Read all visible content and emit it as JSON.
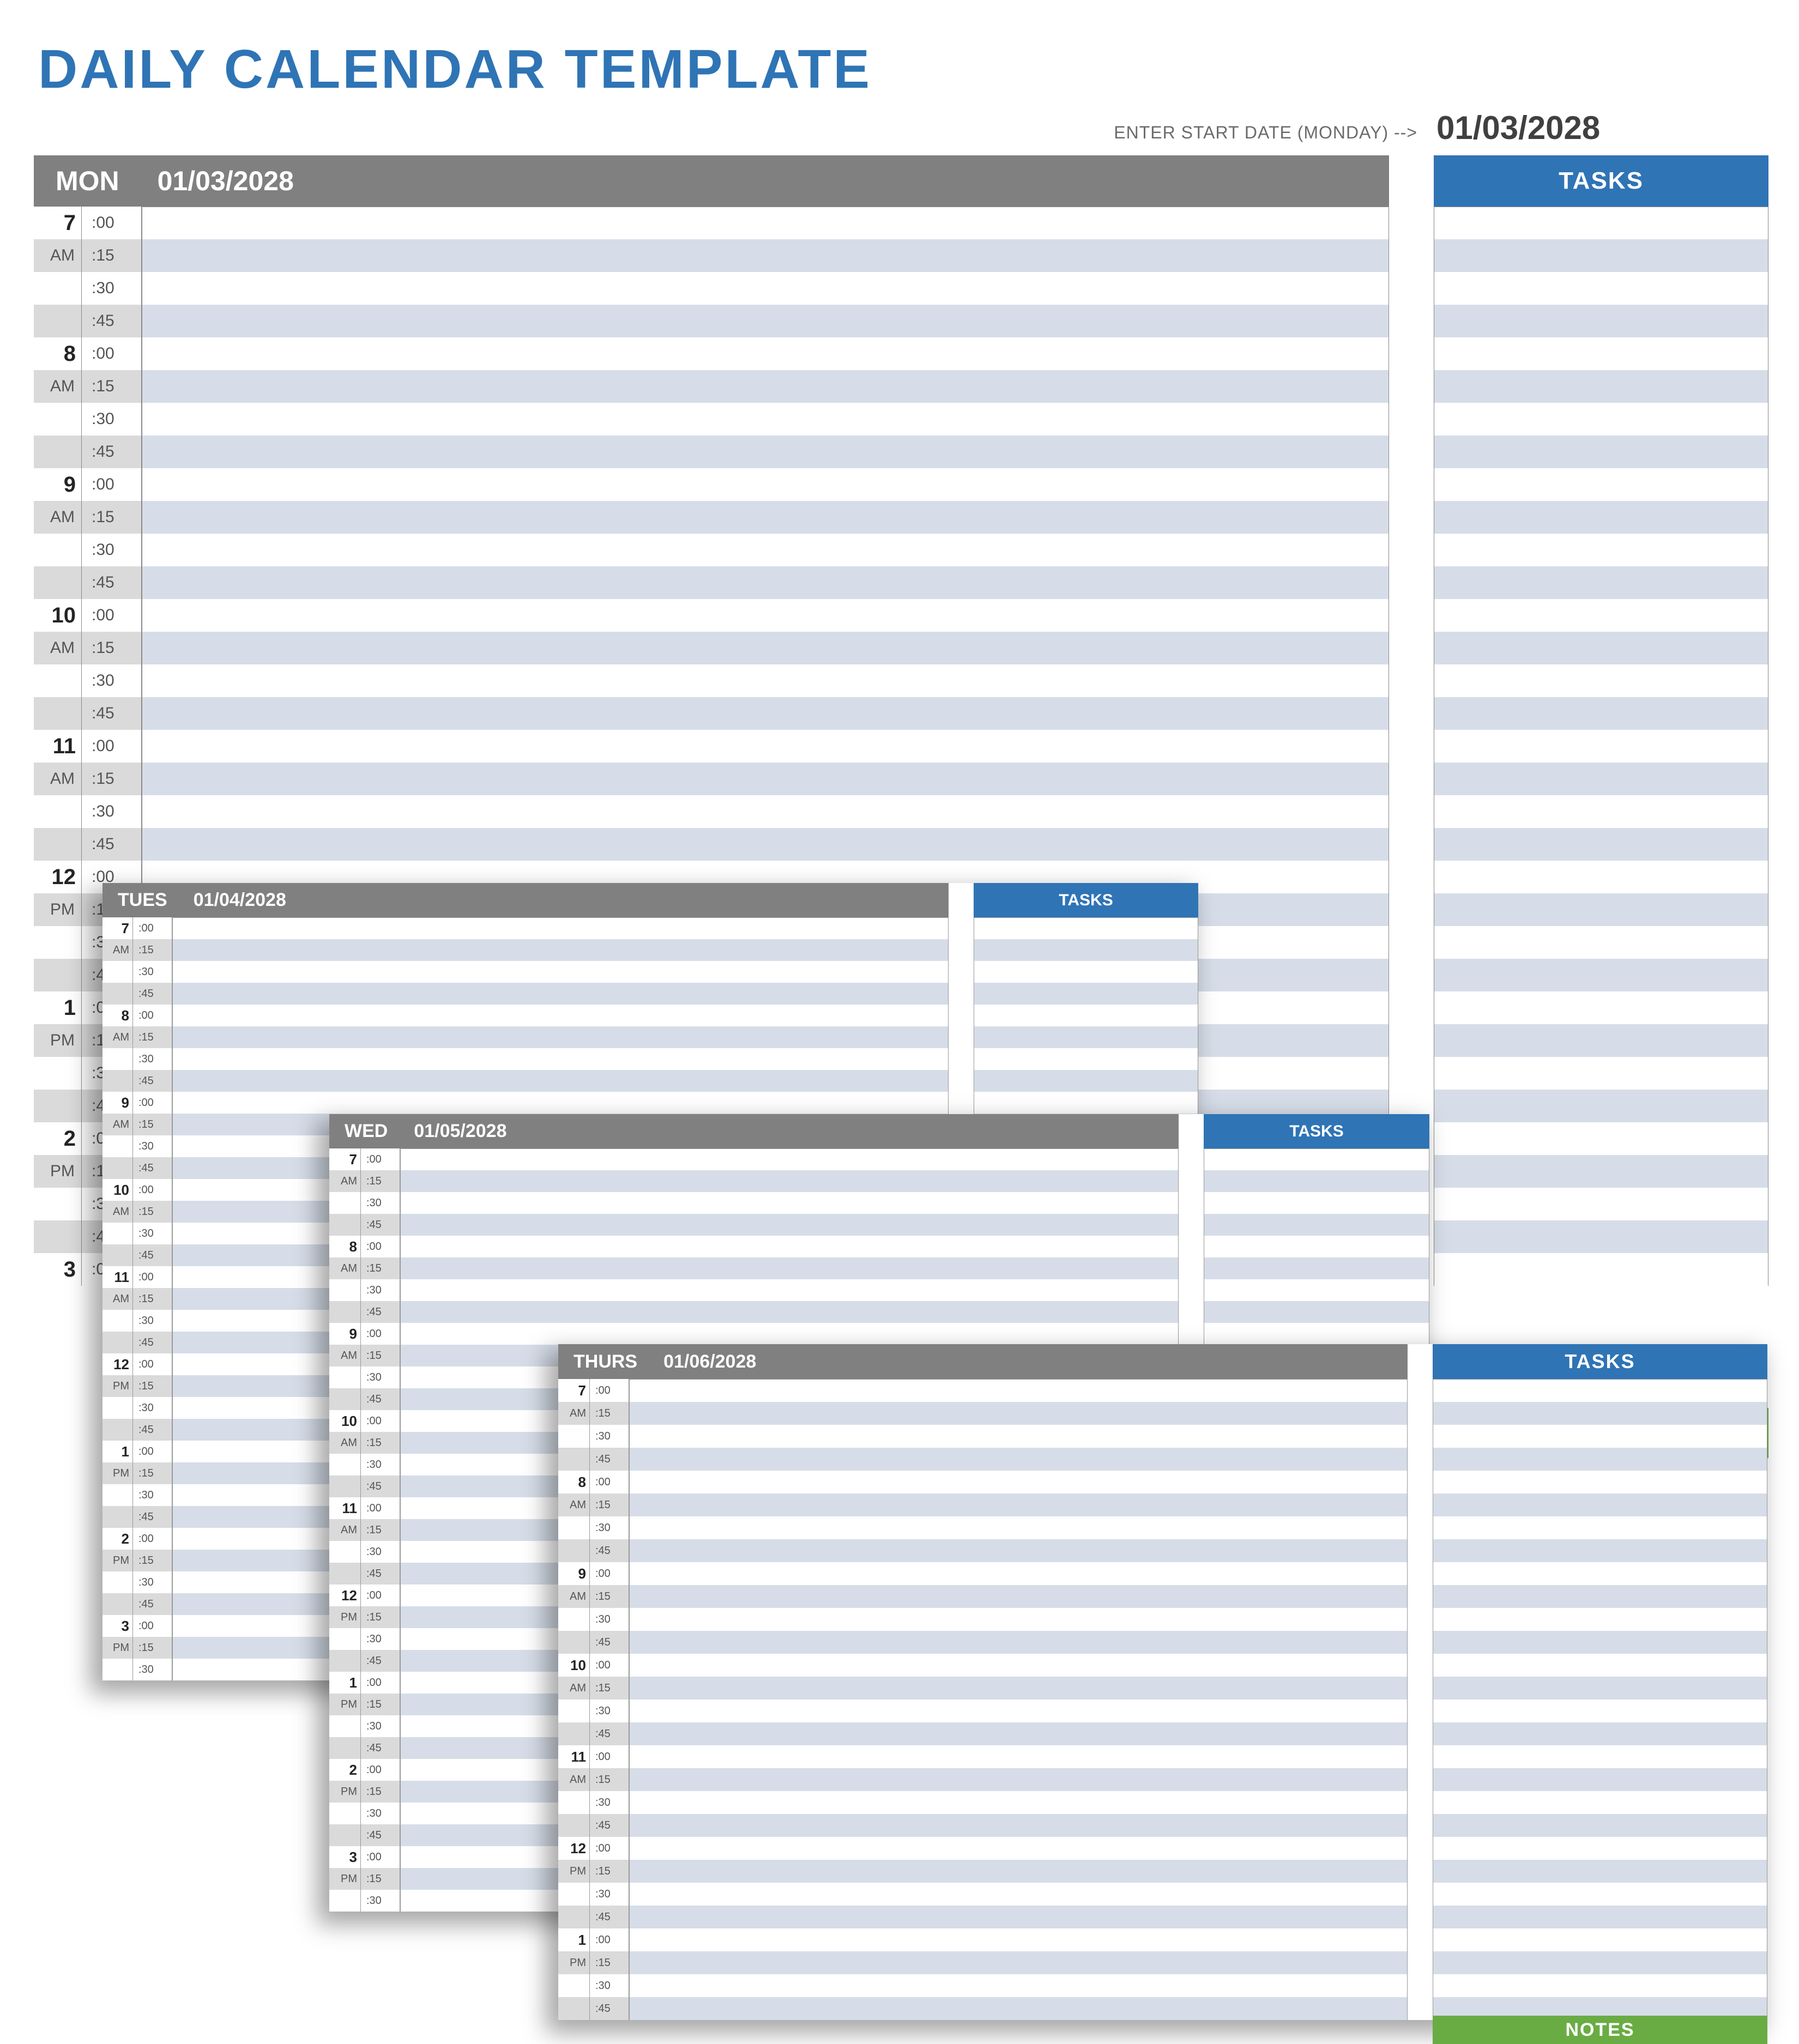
{
  "page": {
    "title": "DAILY CALENDAR TEMPLATE",
    "enter_label": "ENTER START DATE (MONDAY) -->",
    "start_date": "01/03/2028"
  },
  "colors": {
    "title": "#2f74b5",
    "header_gray": "#808080",
    "tasks_blue": "#2f74b5",
    "notes_green": "#6aac44",
    "stripe_blue": "#d6dde8",
    "stripe_gray": "#dadada"
  },
  "headers": {
    "tasks": "TASKS",
    "notes": "NOTES"
  },
  "minutes": [
    ":00",
    ":15",
    ":30",
    ":45"
  ],
  "hours_mon": [
    {
      "h": "7",
      "ampm": "AM"
    },
    {
      "h": "8",
      "ampm": "AM"
    },
    {
      "h": "9",
      "ampm": "AM"
    },
    {
      "h": "10",
      "ampm": "AM"
    },
    {
      "h": "11",
      "ampm": "AM"
    },
    {
      "h": "12",
      "ampm": "PM"
    },
    {
      "h": "1",
      "ampm": "PM"
    },
    {
      "h": "2",
      "ampm": "PM"
    },
    {
      "h": "3",
      "ampm": "PM"
    }
  ],
  "hours_small": [
    {
      "h": "7",
      "ampm": "AM"
    },
    {
      "h": "8",
      "ampm": "AM"
    },
    {
      "h": "9",
      "ampm": "AM"
    },
    {
      "h": "10",
      "ampm": "AM"
    },
    {
      "h": "11",
      "ampm": "AM"
    },
    {
      "h": "12",
      "ampm": "PM"
    },
    {
      "h": "1",
      "ampm": "PM"
    },
    {
      "h": "2",
      "ampm": "PM"
    },
    {
      "h": "3",
      "ampm": "PM"
    }
  ],
  "hours_thurs": [
    {
      "h": "7",
      "ampm": "AM"
    },
    {
      "h": "8",
      "ampm": "AM"
    },
    {
      "h": "9",
      "ampm": "AM"
    },
    {
      "h": "10",
      "ampm": "AM"
    },
    {
      "h": "11",
      "ampm": "AM"
    },
    {
      "h": "12",
      "ampm": "PM"
    },
    {
      "h": "1",
      "ampm": "PM"
    }
  ],
  "days": {
    "mon": {
      "dow": "MON",
      "date": "01/03/2028"
    },
    "tues": {
      "dow": "TUES",
      "date": "01/04/2028"
    },
    "wed": {
      "dow": "WED",
      "date": "01/05/2028"
    },
    "thurs": {
      "dow": "THURS",
      "date": "01/06/2028"
    }
  },
  "notes_fragment": "S"
}
